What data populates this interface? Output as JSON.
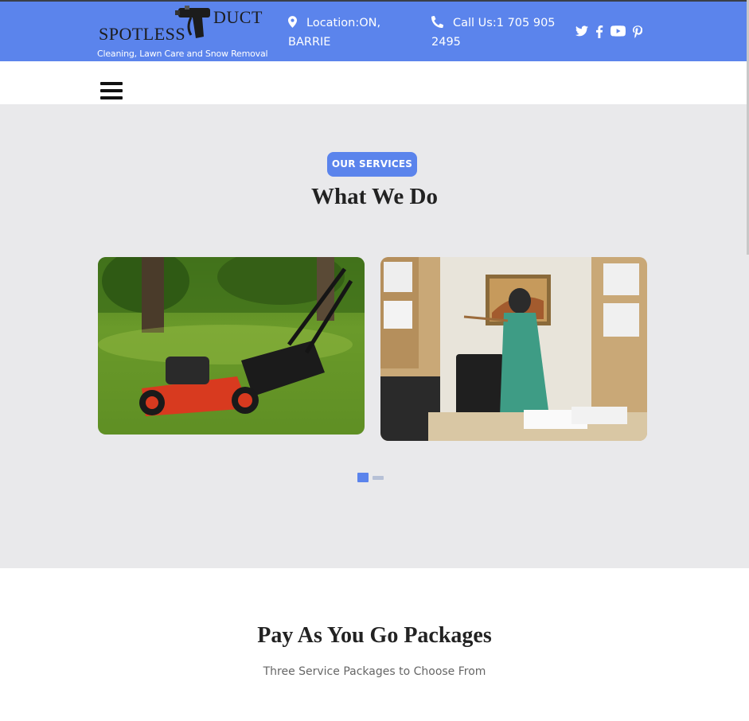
{
  "header": {
    "logo": {
      "word1": "SPOTLESS",
      "word2": "DUCT",
      "tagline": "Cleaning, Lawn Care and Snow Removal"
    },
    "location": {
      "icon": "map-marker-icon",
      "text": "Location:ON, BARRIE"
    },
    "phone": {
      "icon": "phone-icon",
      "text": "Call Us:1 705 905 2495"
    },
    "social": [
      "twitter-icon",
      "facebook-icon",
      "youtube-icon",
      "pinterest-icon"
    ]
  },
  "nav": {
    "menu_icon": "hamburger-menu-icon"
  },
  "services": {
    "badge": "OUR SERVICES",
    "title": "What We Do",
    "cards": [
      {
        "image": "lawn-mower-photo"
      },
      {
        "image": "office-cleaning-photo"
      }
    ],
    "carousel": {
      "pages": 2,
      "active": 1
    }
  },
  "packages": {
    "title": "Pay As You Go Packages",
    "subtitle": "Three Service Packages to Choose From"
  },
  "colors": {
    "brand": "#5b84ec",
    "section_bg": "#e9e9eb",
    "heading": "#222222"
  }
}
